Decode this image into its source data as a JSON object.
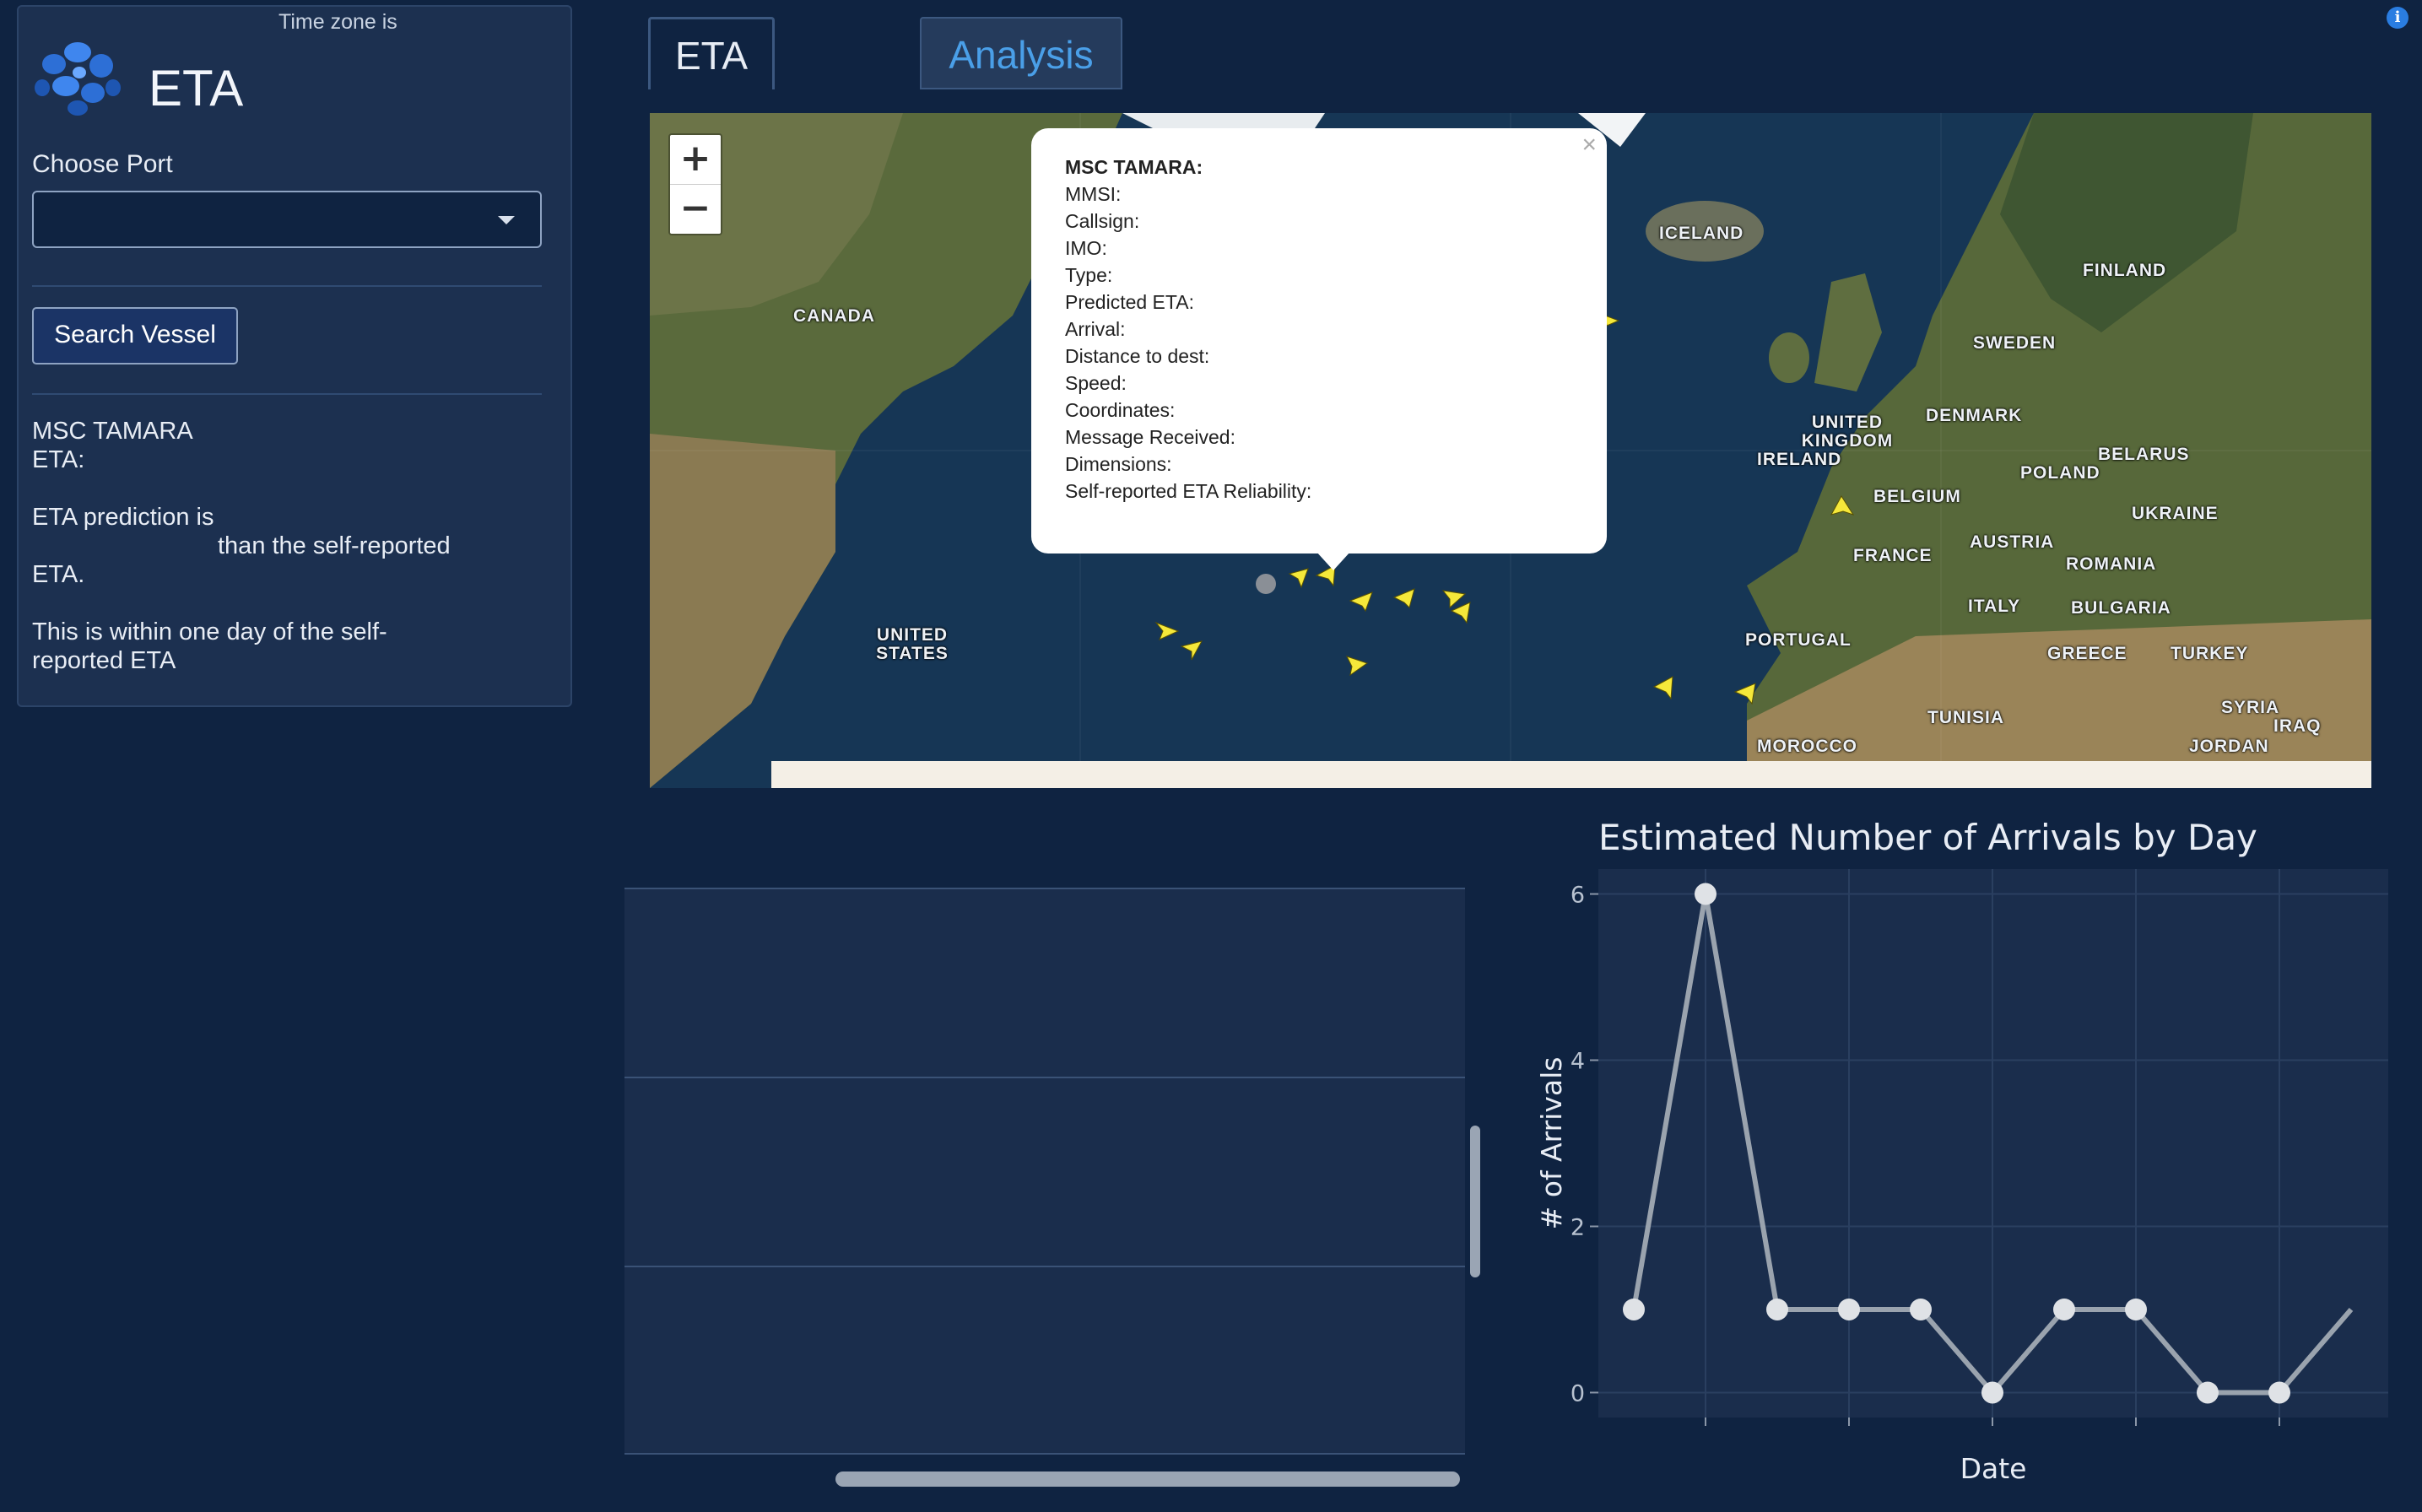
{
  "sidebar": {
    "timezone_label": "Time zone is",
    "app_title": "ETA",
    "choose_port_label": "Choose Port",
    "port_select_value": "",
    "search_button_label": "Search Vessel",
    "vessel_name": "MSC TAMARA",
    "eta_label": "ETA:",
    "prediction_line1": "ETA prediction is",
    "prediction_line2": "than the self-reported",
    "prediction_line3": "ETA.",
    "within_line1": "This is within one day of the self-",
    "within_line2": "reported ETA"
  },
  "tabs": [
    {
      "label": "ETA",
      "active": true
    },
    {
      "label": "Analysis",
      "active": false
    }
  ],
  "info_icon": {
    "name": "info-icon",
    "glyph": "i"
  },
  "map": {
    "zoom_in": "+",
    "zoom_out": "−",
    "labels": [
      "CANADA",
      "ICELAND",
      "FINLAND",
      "SWEDEN",
      "UNITED KINGDOM",
      "IRELAND",
      "DENMARK",
      "BELARUS",
      "POLAND",
      "BELGIUM",
      "UKRAINE",
      "FRANCE",
      "AUSTRIA",
      "ROMANIA",
      "ITALY",
      "BULGARIA",
      "PORTUGAL",
      "GREECE",
      "TURKEY",
      "UNITED STATES",
      "TUNISIA",
      "SYRIA",
      "IRAQ",
      "MOROCCO",
      "JORDAN"
    ],
    "popup": {
      "close": "×",
      "title": "MSC TAMARA:",
      "fields": [
        "MMSI:",
        "Callsign:",
        "IMO:",
        "Type:",
        "Predicted ETA:",
        "Arrival:",
        "Distance to dest:",
        "Speed:",
        "Coordinates:",
        "Message Received:",
        "Dimensions:",
        "Self-reported ETA Reliability:"
      ]
    },
    "marker_color": "#f5e83a"
  },
  "chart_data": {
    "type": "line",
    "title": "Estimated Number of Arrivals by Day",
    "xlabel": "Date",
    "ylabel": "# of Arrivals",
    "yticks": [
      "0",
      "2",
      "4",
      "6"
    ],
    "ylim": [
      -0.3,
      6.3
    ],
    "x": [
      0,
      1,
      2,
      3,
      4,
      5,
      6,
      7,
      8,
      9,
      10
    ],
    "values": [
      1,
      6,
      1,
      1,
      1,
      0,
      1,
      1,
      0,
      0,
      1
    ],
    "colors": {
      "line": "#9aa3ae",
      "marker": "#dfe2e6",
      "plot_bg": "#1a2d4c",
      "grid": "#2a3f60"
    }
  }
}
